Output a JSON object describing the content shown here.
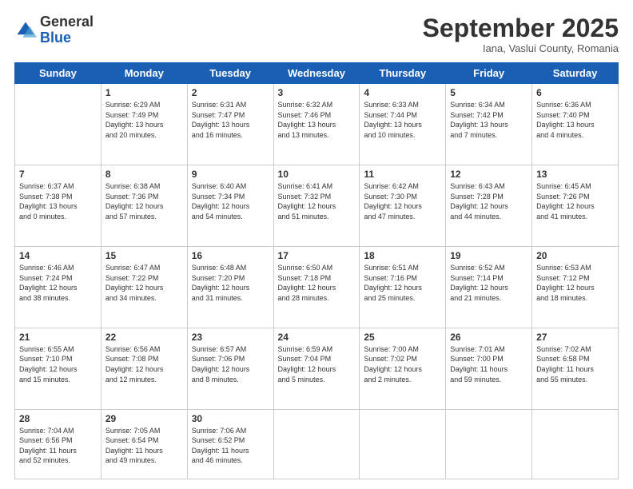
{
  "logo": {
    "general": "General",
    "blue": "Blue"
  },
  "header": {
    "month": "September 2025",
    "location": "Iana, Vaslui County, Romania"
  },
  "weekdays": [
    "Sunday",
    "Monday",
    "Tuesday",
    "Wednesday",
    "Thursday",
    "Friday",
    "Saturday"
  ],
  "weeks": [
    [
      {
        "num": "",
        "info": ""
      },
      {
        "num": "1",
        "info": "Sunrise: 6:29 AM\nSunset: 7:49 PM\nDaylight: 13 hours\nand 20 minutes."
      },
      {
        "num": "2",
        "info": "Sunrise: 6:31 AM\nSunset: 7:47 PM\nDaylight: 13 hours\nand 16 minutes."
      },
      {
        "num": "3",
        "info": "Sunrise: 6:32 AM\nSunset: 7:46 PM\nDaylight: 13 hours\nand 13 minutes."
      },
      {
        "num": "4",
        "info": "Sunrise: 6:33 AM\nSunset: 7:44 PM\nDaylight: 13 hours\nand 10 minutes."
      },
      {
        "num": "5",
        "info": "Sunrise: 6:34 AM\nSunset: 7:42 PM\nDaylight: 13 hours\nand 7 minutes."
      },
      {
        "num": "6",
        "info": "Sunrise: 6:36 AM\nSunset: 7:40 PM\nDaylight: 13 hours\nand 4 minutes."
      }
    ],
    [
      {
        "num": "7",
        "info": "Sunrise: 6:37 AM\nSunset: 7:38 PM\nDaylight: 13 hours\nand 0 minutes."
      },
      {
        "num": "8",
        "info": "Sunrise: 6:38 AM\nSunset: 7:36 PM\nDaylight: 12 hours\nand 57 minutes."
      },
      {
        "num": "9",
        "info": "Sunrise: 6:40 AM\nSunset: 7:34 PM\nDaylight: 12 hours\nand 54 minutes."
      },
      {
        "num": "10",
        "info": "Sunrise: 6:41 AM\nSunset: 7:32 PM\nDaylight: 12 hours\nand 51 minutes."
      },
      {
        "num": "11",
        "info": "Sunrise: 6:42 AM\nSunset: 7:30 PM\nDaylight: 12 hours\nand 47 minutes."
      },
      {
        "num": "12",
        "info": "Sunrise: 6:43 AM\nSunset: 7:28 PM\nDaylight: 12 hours\nand 44 minutes."
      },
      {
        "num": "13",
        "info": "Sunrise: 6:45 AM\nSunset: 7:26 PM\nDaylight: 12 hours\nand 41 minutes."
      }
    ],
    [
      {
        "num": "14",
        "info": "Sunrise: 6:46 AM\nSunset: 7:24 PM\nDaylight: 12 hours\nand 38 minutes."
      },
      {
        "num": "15",
        "info": "Sunrise: 6:47 AM\nSunset: 7:22 PM\nDaylight: 12 hours\nand 34 minutes."
      },
      {
        "num": "16",
        "info": "Sunrise: 6:48 AM\nSunset: 7:20 PM\nDaylight: 12 hours\nand 31 minutes."
      },
      {
        "num": "17",
        "info": "Sunrise: 6:50 AM\nSunset: 7:18 PM\nDaylight: 12 hours\nand 28 minutes."
      },
      {
        "num": "18",
        "info": "Sunrise: 6:51 AM\nSunset: 7:16 PM\nDaylight: 12 hours\nand 25 minutes."
      },
      {
        "num": "19",
        "info": "Sunrise: 6:52 AM\nSunset: 7:14 PM\nDaylight: 12 hours\nand 21 minutes."
      },
      {
        "num": "20",
        "info": "Sunrise: 6:53 AM\nSunset: 7:12 PM\nDaylight: 12 hours\nand 18 minutes."
      }
    ],
    [
      {
        "num": "21",
        "info": "Sunrise: 6:55 AM\nSunset: 7:10 PM\nDaylight: 12 hours\nand 15 minutes."
      },
      {
        "num": "22",
        "info": "Sunrise: 6:56 AM\nSunset: 7:08 PM\nDaylight: 12 hours\nand 12 minutes."
      },
      {
        "num": "23",
        "info": "Sunrise: 6:57 AM\nSunset: 7:06 PM\nDaylight: 12 hours\nand 8 minutes."
      },
      {
        "num": "24",
        "info": "Sunrise: 6:59 AM\nSunset: 7:04 PM\nDaylight: 12 hours\nand 5 minutes."
      },
      {
        "num": "25",
        "info": "Sunrise: 7:00 AM\nSunset: 7:02 PM\nDaylight: 12 hours\nand 2 minutes."
      },
      {
        "num": "26",
        "info": "Sunrise: 7:01 AM\nSunset: 7:00 PM\nDaylight: 11 hours\nand 59 minutes."
      },
      {
        "num": "27",
        "info": "Sunrise: 7:02 AM\nSunset: 6:58 PM\nDaylight: 11 hours\nand 55 minutes."
      }
    ],
    [
      {
        "num": "28",
        "info": "Sunrise: 7:04 AM\nSunset: 6:56 PM\nDaylight: 11 hours\nand 52 minutes."
      },
      {
        "num": "29",
        "info": "Sunrise: 7:05 AM\nSunset: 6:54 PM\nDaylight: 11 hours\nand 49 minutes."
      },
      {
        "num": "30",
        "info": "Sunrise: 7:06 AM\nSunset: 6:52 PM\nDaylight: 11 hours\nand 46 minutes."
      },
      {
        "num": "",
        "info": ""
      },
      {
        "num": "",
        "info": ""
      },
      {
        "num": "",
        "info": ""
      },
      {
        "num": "",
        "info": ""
      }
    ]
  ]
}
